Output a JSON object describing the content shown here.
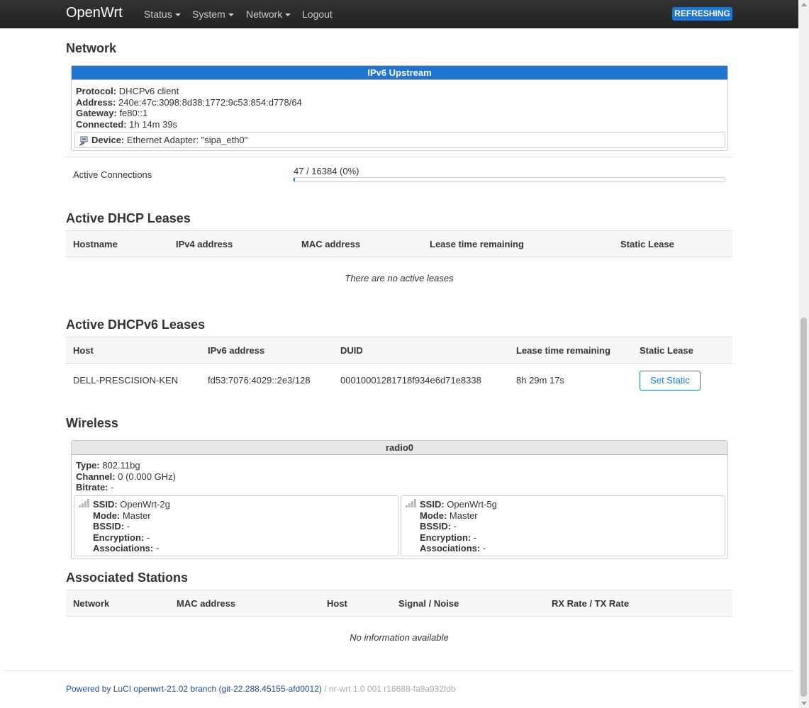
{
  "nav": {
    "brand": "OpenWrt",
    "items": [
      {
        "label": "Status",
        "caret": true
      },
      {
        "label": "System",
        "caret": true
      },
      {
        "label": "Network",
        "caret": true
      },
      {
        "label": "Logout",
        "caret": false
      }
    ],
    "refresh_badge": "REFRESHING"
  },
  "network": {
    "title": "Network",
    "upstream": {
      "header": "IPv6 Upstream",
      "protocol_label": "Protocol:",
      "protocol": "DHCPv6 client",
      "address_label": "Address:",
      "address": "240e:47c:3098:8d38:1772:9c53:854:d778/64",
      "gateway_label": "Gateway:",
      "gateway": "fe80::1",
      "connected_label": "Connected:",
      "connected": "1h 14m 39s",
      "device_label": "Device:",
      "device": "Ethernet Adapter: \"sipa_eth0\"",
      "device_icon": "ethernet-icon"
    },
    "active_connections": {
      "label": "Active Connections",
      "value": "47 / 16384 (0%)",
      "fraction": 0.0029
    }
  },
  "dhcp_leases": {
    "title": "Active DHCP Leases",
    "columns": [
      "Hostname",
      "IPv4 address",
      "MAC address",
      "Lease time remaining",
      "Static Lease"
    ],
    "empty_text": "There are no active leases"
  },
  "dhcpv6_leases": {
    "title": "Active DHCPv6 Leases",
    "columns": [
      "Host",
      "IPv6 address",
      "DUID",
      "Lease time remaining",
      "Static Lease"
    ],
    "rows": [
      {
        "host": "DELL-PRESCISION-KEN",
        "ipv6": "fd53:7076:4029::2e3/128",
        "duid": "00010001281718f934e6d71e8338",
        "lease": "8h 29m 17s",
        "action": "Set Static"
      }
    ]
  },
  "wireless": {
    "title": "Wireless",
    "radio": {
      "header": "radio0",
      "type_label": "Type:",
      "type": "802.11bg",
      "channel_label": "Channel:",
      "channel": "0 (0.000 GHz)",
      "bitrate_label": "Bitrate:",
      "bitrate": "-",
      "networks": [
        {
          "ssid_label": "SSID:",
          "ssid": "OpenWrt-2g",
          "mode_label": "Mode:",
          "mode": "Master",
          "bssid_label": "BSSID:",
          "bssid": "-",
          "enc_label": "Encryption:",
          "enc": "-",
          "assoc_label": "Associations:",
          "assoc": "-",
          "icon": "signal-icon"
        },
        {
          "ssid_label": "SSID:",
          "ssid": "OpenWrt-5g",
          "mode_label": "Mode:",
          "mode": "Master",
          "bssid_label": "BSSID:",
          "bssid": "-",
          "enc_label": "Encryption:",
          "enc": "-",
          "assoc_label": "Associations:",
          "assoc": "-",
          "icon": "signal-icon"
        }
      ]
    }
  },
  "stations": {
    "title": "Associated Stations",
    "columns": [
      "Network",
      "MAC address",
      "Host",
      "Signal / Noise",
      "RX Rate / TX Rate"
    ],
    "empty_text": "No information available"
  },
  "footer": {
    "luci_link": "Powered by LuCI openwrt-21.02 branch (git-22.288.45155-afd0012)",
    "separator": " / ",
    "version": "nr-wrt 1.0 001 r16688-fa9a932fdb"
  },
  "colors": {
    "accent": "#1c76d2",
    "navbar": "#222222",
    "link": "#1c4fa3"
  }
}
